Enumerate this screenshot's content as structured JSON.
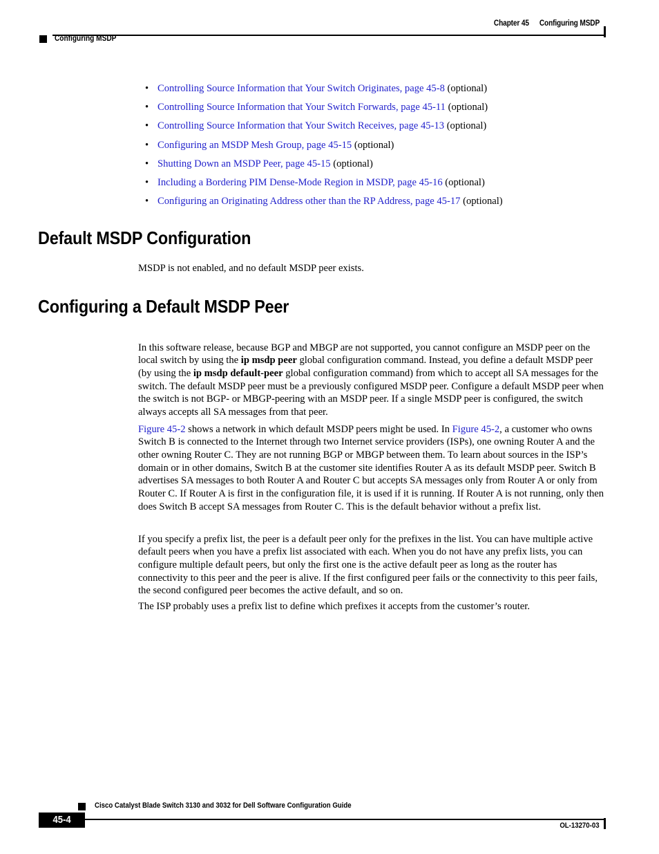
{
  "header": {
    "chapter_label": "Chapter 45",
    "chapter_title": "Configuring MSDP",
    "left_marker_label": "Configuring MSDP"
  },
  "bullets": [
    {
      "link": "Controlling Source Information that Your Switch Originates, page 45-8",
      "suffix": " (optional)"
    },
    {
      "link": "Controlling Source Information that Your Switch Forwards, page 45-11",
      "suffix": " (optional)"
    },
    {
      "link": "Controlling Source Information that Your Switch Receives, page 45-13",
      "suffix": " (optional)"
    },
    {
      "link": "Configuring an MSDP Mesh Group, page 45-15",
      "suffix": " (optional)"
    },
    {
      "link": "Shutting Down an MSDP Peer, page 45-15",
      "suffix": " (optional)"
    },
    {
      "link": "Including a Bordering PIM Dense-Mode Region in MSDP, page 45-16",
      "suffix": " (optional)"
    },
    {
      "link": "Configuring an Originating Address other than the RP Address, page 45-17",
      "suffix": " (optional)"
    }
  ],
  "sections": [
    {
      "heading": "Default MSDP Configuration",
      "body": "MSDP is not enabled, and no default MSDP peer exists."
    },
    {
      "heading": "Configuring a Default MSDP Peer"
    }
  ],
  "paragraphs": {
    "p1": {
      "t1": "In this software release, because BGP and MBGP are not supported, you cannot configure an MSDP peer on the local switch by using the ",
      "cmd1": "ip msdp peer",
      "t2": " global configuration command. Instead, you define a default MSDP peer (by using the ",
      "cmd2": "ip msdp default-peer",
      "t3": " global configuration command) from which to accept all SA messages for the switch. The default MSDP peer must be a previously configured MSDP peer. Configure a default MSDP peer when the switch is not BGP- or MBGP-peering with an MSDP peer. If a single MSDP peer is configured, the switch always accepts all SA messages from that peer."
    },
    "p2": {
      "fig1": "Figure 45-2",
      "t1": " shows a network in which default MSDP peers might be used. In ",
      "fig2": "Figure 45-2",
      "t2": ", a customer who owns Switch B is connected to the Internet through two Internet service providers (ISPs), one owning Router A and the other owning Router C. They are not running BGP or MBGP between them. To learn about sources in the ISP’s domain or in other domains, Switch B at the customer site identifies Router A as its default MSDP peer. Switch B advertises SA messages to both Router A and Router C but accepts SA messages only from Router A or only from Router C. If Router A is first in the configuration file, it is used if it is running. If Router A is not running, only then does Switch B accept SA messages from Router C. This is the default behavior without a prefix list."
    },
    "p3": "If you specify a prefix list, the peer is a default peer only for the prefixes in the list. You can have multiple active default peers when you have a prefix list associated with each. When you do not have any prefix lists, you can configure multiple default peers, but only the first one is the active default peer as long as the router has connectivity to this peer and the peer is alive. If the first configured peer fails or the connectivity to this peer fails, the second configured peer becomes the active default, and so on.",
    "p4": "The ISP probably uses a prefix list to define which prefixes it accepts from the customer’s router."
  },
  "footer": {
    "guide_title": "Cisco Catalyst Blade Switch 3130 and 3032 for Dell Software Configuration Guide",
    "page_number": "45-4",
    "doc_id": "OL-13270-03"
  },
  "colors": {
    "link_blue": "#2222cc",
    "text_black": "#000000",
    "page_background": "#ffffff"
  },
  "bullet_glyph": "•"
}
